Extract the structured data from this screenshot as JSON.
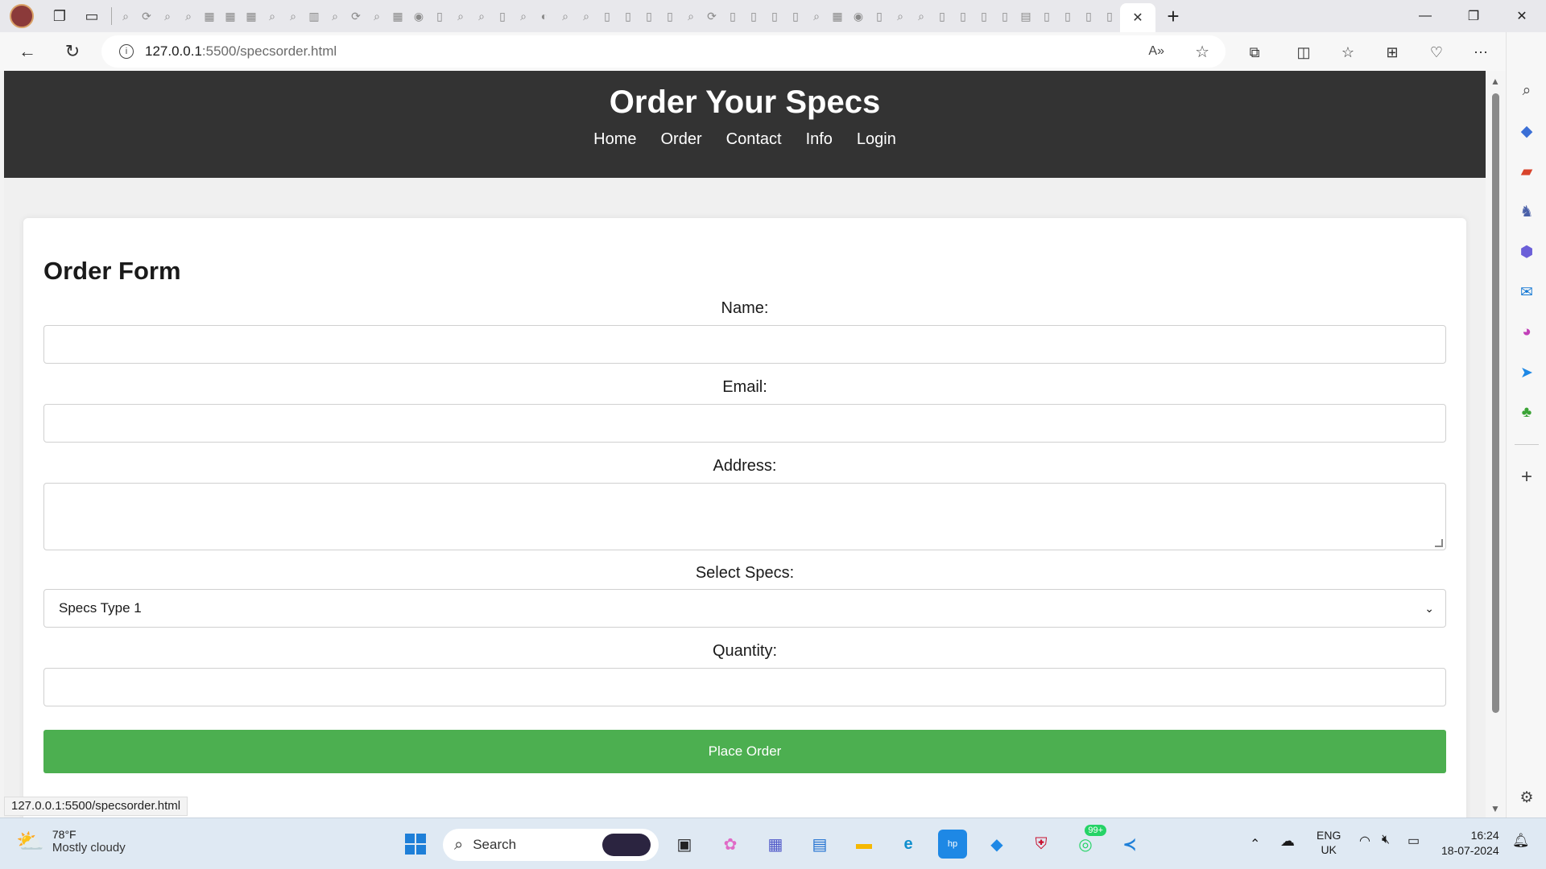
{
  "browser": {
    "active_tab_close": "✕",
    "new_tab": "+",
    "address": {
      "host": "127.0.0.1",
      "rest": ":5500/specsorder.html"
    },
    "status_bar_url": "127.0.0.1:5500/specsorder.html"
  },
  "site": {
    "title": "Order Your Specs",
    "nav": [
      "Home",
      "Order",
      "Contact",
      "Info",
      "Login"
    ]
  },
  "form": {
    "title": "Order Form",
    "name_label": "Name:",
    "email_label": "Email:",
    "address_label": "Address:",
    "specs_label": "Select Specs:",
    "specs_selected": "Specs Type 1",
    "quantity_label": "Quantity:",
    "submit_label": "Place Order"
  },
  "taskbar": {
    "weather_temp": "78°F",
    "weather_desc": "Mostly cloudy",
    "search_placeholder": "Search",
    "whatsapp_badge": "99+",
    "lang_line1": "ENG",
    "lang_line2": "UK",
    "time": "16:24",
    "date": "18-07-2024"
  },
  "colors": {
    "header_bg": "#333333",
    "submit_bg": "#4caf50",
    "page_bg": "#f0f0f0"
  }
}
